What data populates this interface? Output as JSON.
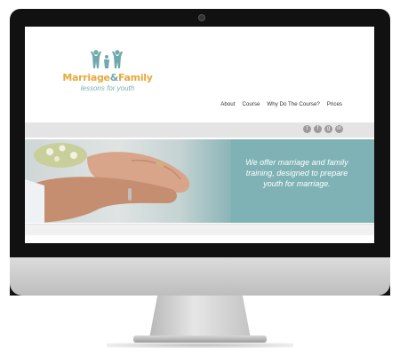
{
  "site": {
    "logo": {
      "title_part1": "Marriage",
      "title_amp": "&",
      "title_part2": "Family",
      "subtitle": "lessons for youth"
    },
    "nav": [
      "About",
      "Course",
      "Why Do The Course?",
      "Prices"
    ],
    "social_icons": [
      "twitter-icon",
      "facebook-icon",
      "google-plus-icon",
      "linkedin-icon"
    ],
    "social_glyphs": [
      "t",
      "f",
      "g",
      "in"
    ],
    "banner": {
      "tagline": "We offer marriage and family training, designed to prepare youth for marriage."
    },
    "colors": {
      "accent_teal": "#7fb2b5",
      "logo_orange": "#e8a83c",
      "logo_teal": "#6fa9ab"
    }
  }
}
